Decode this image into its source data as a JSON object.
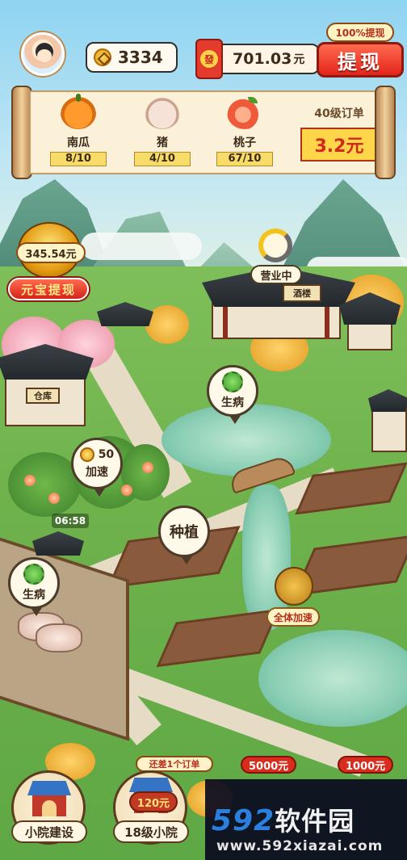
{
  "header": {
    "coins": "3334",
    "cash_amount": "701.03",
    "cash_unit": "元",
    "envelope_char": "發",
    "withdraw_tag": "100%提现",
    "withdraw_button": "提现"
  },
  "order": {
    "items": [
      {
        "name": "南瓜",
        "count": "8/10",
        "icon": "pumpkin-icon"
      },
      {
        "name": "猪",
        "count": "4/10",
        "icon": "pig-icon"
      },
      {
        "name": "桃子",
        "count": "67/10",
        "icon": "peach-icon"
      }
    ],
    "level_label": "40级订单",
    "reward": "3.2元"
  },
  "ingot": {
    "amount": "345.54元",
    "button": "元宝提现"
  },
  "map": {
    "shop_status": "营业中",
    "shop_sign": "酒楼",
    "warehouse_sign": "仓库",
    "sick_label_1": "生病",
    "sick_label_2": "生病",
    "speedup_cost": "50",
    "speedup_label": "加速",
    "timer": "06:58",
    "plant_label": "种植",
    "all_speedup": "全体加速"
  },
  "bottom": {
    "build_label": "小院建设",
    "level_note": "还差1个订单",
    "level_reward": "120元",
    "level_label": "18级小院",
    "reward_1": "5000元",
    "reward_2": "1000元"
  },
  "watermark": {
    "logo_num": "592",
    "logo_cn": "软件园",
    "url": "www.592xiazai.com"
  }
}
